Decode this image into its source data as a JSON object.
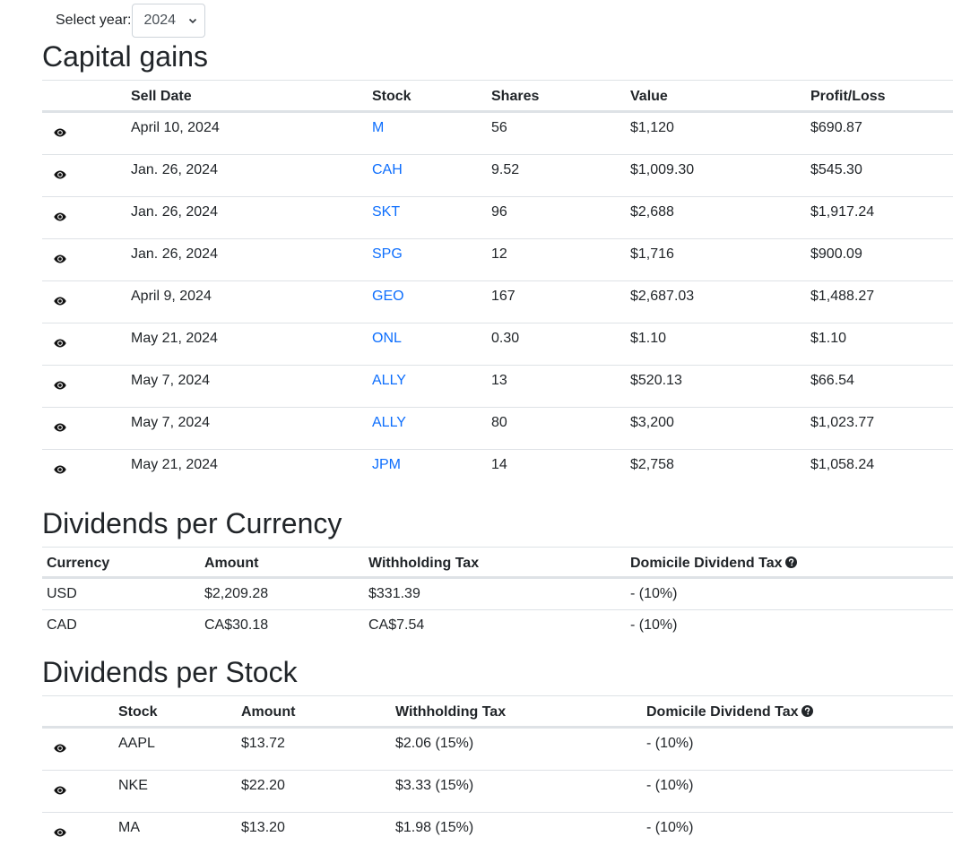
{
  "year_selector": {
    "label": "Select year:",
    "selected": "2024",
    "icon": "chevron-down-icon"
  },
  "capital_gains": {
    "title": "Capital gains",
    "headers": {
      "sell_date": "Sell Date",
      "stock": "Stock",
      "shares": "Shares",
      "value": "Value",
      "profit_loss": "Profit/Loss"
    },
    "rows": [
      {
        "sell_date": "April 10, 2024",
        "stock": "M",
        "shares": "56",
        "value": "$1,120",
        "profit_loss": "$690.87"
      },
      {
        "sell_date": "Jan. 26, 2024",
        "stock": "CAH",
        "shares": "9.52",
        "value": "$1,009.30",
        "profit_loss": "$545.30"
      },
      {
        "sell_date": "Jan. 26, 2024",
        "stock": "SKT",
        "shares": "96",
        "value": "$2,688",
        "profit_loss": "$1,917.24"
      },
      {
        "sell_date": "Jan. 26, 2024",
        "stock": "SPG",
        "shares": "12",
        "value": "$1,716",
        "profit_loss": "$900.09"
      },
      {
        "sell_date": "April 9, 2024",
        "stock": "GEO",
        "shares": "167",
        "value": "$2,687.03",
        "profit_loss": "$1,488.27"
      },
      {
        "sell_date": "May 21, 2024",
        "stock": "ONL",
        "shares": "0.30",
        "value": "$1.10",
        "profit_loss": "$1.10"
      },
      {
        "sell_date": "May 7, 2024",
        "stock": "ALLY",
        "shares": "13",
        "value": "$520.13",
        "profit_loss": "$66.54"
      },
      {
        "sell_date": "May 7, 2024",
        "stock": "ALLY",
        "shares": "80",
        "value": "$3,200",
        "profit_loss": "$1,023.77"
      },
      {
        "sell_date": "May 21, 2024",
        "stock": "JPM",
        "shares": "14",
        "value": "$2,758",
        "profit_loss": "$1,058.24"
      }
    ]
  },
  "dividends_per_currency": {
    "title": "Dividends per Currency",
    "headers": {
      "currency": "Currency",
      "amount": "Amount",
      "withholding_tax": "Withholding Tax",
      "domicile_tax": "Domicile Dividend Tax"
    },
    "rows": [
      {
        "currency": "USD",
        "amount": "$2,209.28",
        "withholding_tax": "$331.39",
        "domicile_tax": "- (10%)"
      },
      {
        "currency": "CAD",
        "amount": "CA$30.18",
        "withholding_tax": "CA$7.54",
        "domicile_tax": "- (10%)"
      }
    ]
  },
  "dividends_per_stock": {
    "title": "Dividends per Stock",
    "headers": {
      "stock": "Stock",
      "amount": "Amount",
      "withholding_tax": "Withholding Tax",
      "domicile_tax": "Domicile Dividend Tax"
    },
    "rows": [
      {
        "stock": "AAPL",
        "amount": "$13.72",
        "withholding_tax": "$2.06 (15%)",
        "domicile_tax": "- (10%)"
      },
      {
        "stock": "NKE",
        "amount": "$22.20",
        "withholding_tax": "$3.33 (15%)",
        "domicile_tax": "- (10%)"
      },
      {
        "stock": "MA",
        "amount": "$13.20",
        "withholding_tax": "$1.98 (15%)",
        "domicile_tax": "- (10%)"
      }
    ]
  },
  "colors": {
    "link": "#0d6efd",
    "text": "#212529",
    "border": "#dee2e6"
  }
}
